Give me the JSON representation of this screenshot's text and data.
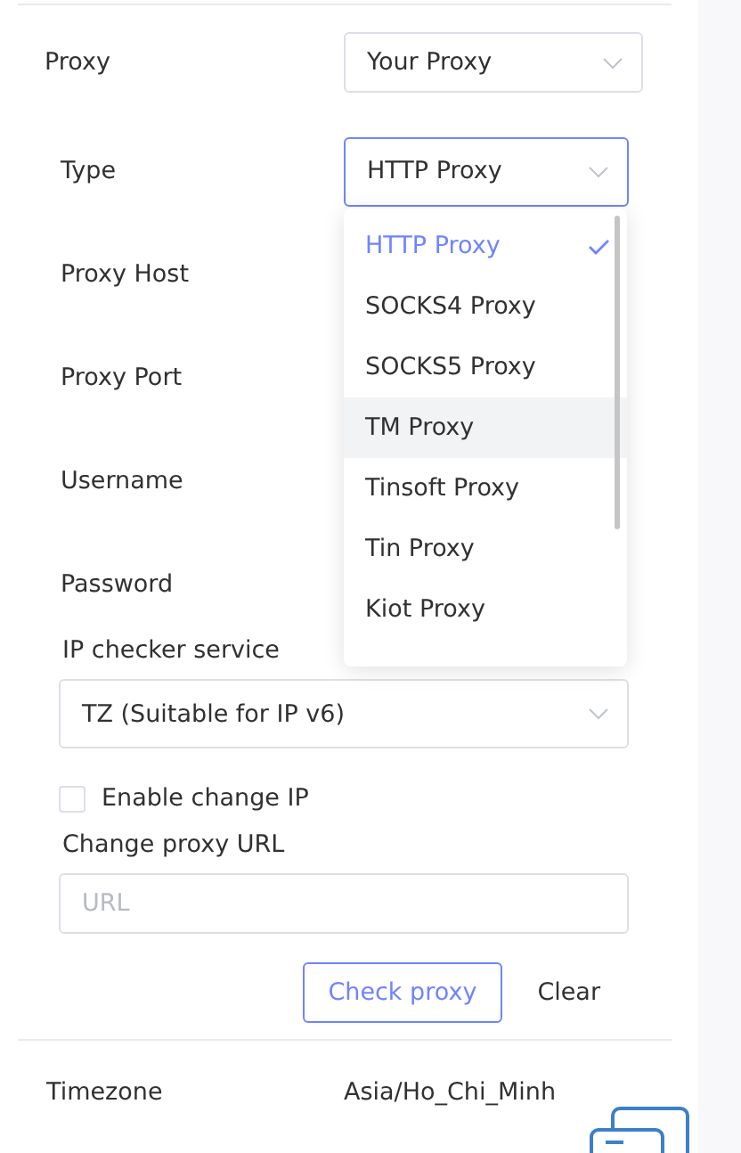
{
  "proxy": {
    "label": "Proxy",
    "value": "Your Proxy"
  },
  "type": {
    "label": "Type",
    "value": "HTTP Proxy",
    "focused": true
  },
  "fields": [
    {
      "label": "Proxy Host"
    },
    {
      "label": "Proxy Port"
    },
    {
      "label": "Username"
    },
    {
      "label": "Password"
    }
  ],
  "dropdown": {
    "options": [
      {
        "label": "HTTP Proxy",
        "selected": true,
        "hovered": false
      },
      {
        "label": "SOCKS4 Proxy",
        "selected": false,
        "hovered": false
      },
      {
        "label": "SOCKS5 Proxy",
        "selected": false,
        "hovered": false
      },
      {
        "label": "TM Proxy",
        "selected": false,
        "hovered": true
      },
      {
        "label": "Tinsoft Proxy",
        "selected": false,
        "hovered": false
      },
      {
        "label": "Tin Proxy",
        "selected": false,
        "hovered": false
      },
      {
        "label": "Kiot Proxy",
        "selected": false,
        "hovered": false
      }
    ]
  },
  "ip_checker": {
    "label": "IP checker service",
    "value": "TZ (Suitable for IP v6)"
  },
  "enable_change_ip": {
    "label": "Enable change IP",
    "checked": false
  },
  "change_url": {
    "label": "Change proxy URL",
    "placeholder": "URL"
  },
  "buttons": [
    {
      "label": "Check proxy",
      "kind": "outline"
    },
    {
      "label": "Clear",
      "kind": "text"
    }
  ],
  "timezone": {
    "label": "Timezone",
    "value": "Asia/Ho_Chi_Minh"
  }
}
